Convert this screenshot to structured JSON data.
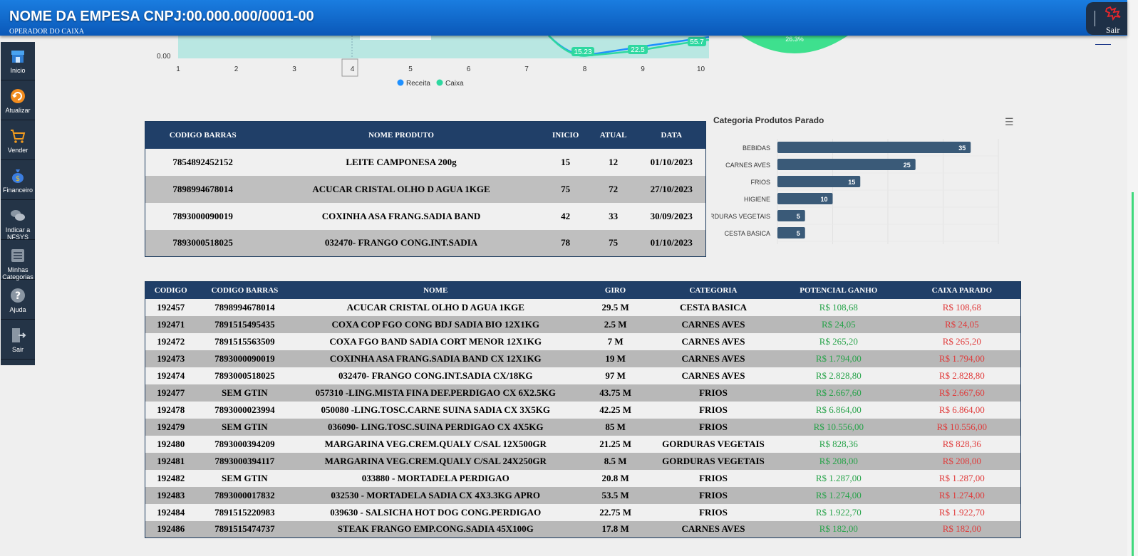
{
  "header": {
    "company": "NOME DA EMPESA CNPJ:00.000.000/0001-00",
    "operator": "OPERADOR DO CAIXA",
    "exit_label": "Sair"
  },
  "sidebar": {
    "items": [
      {
        "label": "Inicio",
        "icon": "store-icon"
      },
      {
        "label": "Atualizar",
        "icon": "refresh-icon"
      },
      {
        "label": "Vender",
        "icon": "cart-icon"
      },
      {
        "label": "Financeiro",
        "icon": "money-bag-icon"
      },
      {
        "label": "Indicar a NFSYS",
        "icon": "chat-icon"
      },
      {
        "label": "Minhas Categorias",
        "icon": "list-icon"
      },
      {
        "label": "Ajuda",
        "icon": "help-icon"
      },
      {
        "label": "Sair",
        "icon": "exit-icon"
      }
    ]
  },
  "line_chart": {
    "y_tick": "0.00",
    "x_ticks": [
      "1",
      "2",
      "3",
      "4",
      "5",
      "6",
      "7",
      "8",
      "9",
      "10"
    ],
    "highlight_x": "4",
    "labels": [
      "15.23",
      "22.5",
      "55.7"
    ],
    "legend": [
      {
        "name": "Receita",
        "color": "#1e90ff"
      },
      {
        "name": "Caixa",
        "color": "#2ed8a0"
      }
    ],
    "donut_label": "26.3%"
  },
  "table1": {
    "headers": [
      "CODIGO BARRAS",
      "NOME PRODUTO",
      "INICIO",
      "ATUAL",
      "DATA"
    ],
    "rows": [
      [
        "7854892452152",
        "LEITE CAMPONESA 200g",
        "15",
        "12",
        "01/10/2023"
      ],
      [
        "7898994678014",
        "ACUCAR CRISTAL OLHO D AGUA 1KGE",
        "75",
        "72",
        "27/10/2023"
      ],
      [
        "7893000090019",
        "COXINHA ASA FRANG.SADIA BAND",
        "42",
        "33",
        "30/09/2023"
      ],
      [
        "7893000518025",
        "032470- FRANGO CONG.INT.SADIA",
        "78",
        "75",
        "01/10/2023"
      ]
    ]
  },
  "chart_data": {
    "type": "bar",
    "title": "Categoria Produtos Parado",
    "categories": [
      "BEBIDAS",
      "CARNES AVES",
      "FRIOS",
      "HIGIENE",
      "GORDURAS VEGETAIS",
      "CESTA BASICA"
    ],
    "values": [
      35,
      25,
      15,
      10,
      5,
      5
    ],
    "xlim": [
      0,
      40
    ],
    "color": "#3a5a78"
  },
  "table2": {
    "headers": [
      "CODIGO",
      "CODIGO BARRAS",
      "NOME",
      "GIRO",
      "CATEGORIA",
      "POTENCIAL GANHO",
      "CAIXA PARADO"
    ],
    "rows": [
      [
        "192457",
        "7898994678014",
        "ACUCAR CRISTAL OLHO D AGUA 1KGE",
        "29.5 M",
        "CESTA BASICA",
        "R$ 108,68",
        "R$ 108,68"
      ],
      [
        "192471",
        "7891515495435",
        "COXA COP FGO CONG BDJ SADIA BIO 12X1KG",
        "2.5 M",
        "CARNES AVES",
        "R$ 24,05",
        "R$ 24,05"
      ],
      [
        "192472",
        "7891515563509",
        "COXA FGO BAND SADIA CORT MENOR 12X1KG",
        "7 M",
        "CARNES AVES",
        "R$ 265,20",
        "R$ 265,20"
      ],
      [
        "192473",
        "7893000090019",
        "COXINHA ASA FRANG.SADIA BAND CX 12X1KG",
        "19 M",
        "CARNES AVES",
        "R$ 1.794,00",
        "R$ 1.794,00"
      ],
      [
        "192474",
        "7893000518025",
        "032470- FRANGO CONG.INT.SADIA CX/18KG",
        "97 M",
        "CARNES AVES",
        "R$ 2.828,80",
        "R$ 2.828,80"
      ],
      [
        "192477",
        "SEM GTIN",
        "057310 -LING.MISTA FINA DEF.PERDIGAO CX 6X2.5KG",
        "43.75 M",
        "FRIOS",
        "R$ 2.667,60",
        "R$ 2.667,60"
      ],
      [
        "192478",
        "7893000023994",
        "050080 -LING.TOSC.CARNE SUINA SADIA CX 3X5KG",
        "42.25 M",
        "FRIOS",
        "R$ 6.864,00",
        "R$ 6.864,00"
      ],
      [
        "192479",
        "SEM GTIN",
        "036090- LING.TOSC.SUINA PERDIGAO CX 4X5KG",
        "85 M",
        "FRIOS",
        "R$ 10.556,00",
        "R$ 10.556,00"
      ],
      [
        "192480",
        "7893000394209",
        "MARGARINA VEG.CREM.QUALY C/SAL 12X500GR",
        "21.25 M",
        "GORDURAS VEGETAIS",
        "R$ 828,36",
        "R$ 828,36"
      ],
      [
        "192481",
        "7893000394117",
        "MARGARINA VEG.CREM.QUALY C/SAL 24X250GR",
        "8.5 M",
        "GORDURAS VEGETAIS",
        "R$ 208,00",
        "R$ 208,00"
      ],
      [
        "192482",
        "SEM GTIN",
        "033880 - MORTADELA PERDIGAO",
        "20.8 M",
        "FRIOS",
        "R$ 1.287,00",
        "R$ 1.287,00"
      ],
      [
        "192483",
        "7893000017832",
        "032530 - MORTADELA SADIA CX 4X3.3KG APRO",
        "53.5 M",
        "FRIOS",
        "R$ 1.274,00",
        "R$ 1.274,00"
      ],
      [
        "192484",
        "7891515220983",
        "039630 - SALSICHA HOT DOG CONG.PERDIGAO",
        "22.75 M",
        "FRIOS",
        "R$ 1.922,70",
        "R$ 1.922,70"
      ],
      [
        "192486",
        "7891515474737",
        "STEAK FRANGO EMP.CONG.SADIA 45X100G",
        "17.8 M",
        "CARNES AVES",
        "R$ 182,00",
        "R$ 182,00"
      ]
    ]
  }
}
